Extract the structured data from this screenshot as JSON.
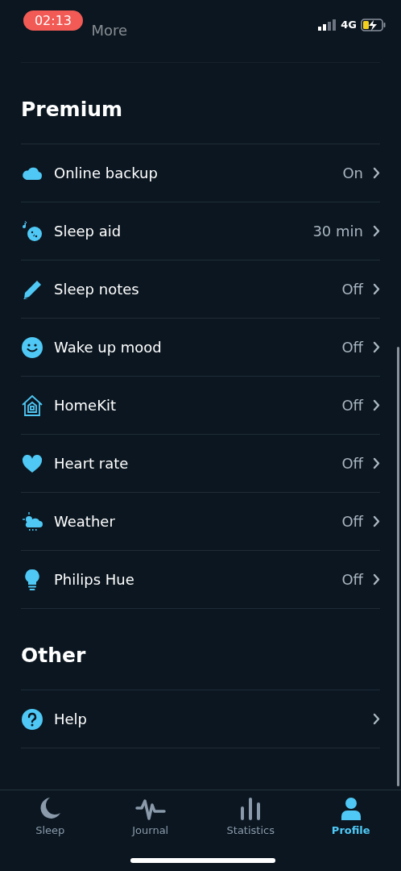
{
  "status_bar": {
    "time": "02:13",
    "network": "4G"
  },
  "partial_row": {
    "label": "More"
  },
  "sections": [
    {
      "title": "Premium",
      "items": [
        {
          "label": "Online backup",
          "value": "On"
        },
        {
          "label": "Sleep aid",
          "value": "30 min"
        },
        {
          "label": "Sleep notes",
          "value": "Off"
        },
        {
          "label": "Wake up mood",
          "value": "Off"
        },
        {
          "label": "HomeKit",
          "value": "Off"
        },
        {
          "label": "Heart rate",
          "value": "Off"
        },
        {
          "label": "Weather",
          "value": "Off"
        },
        {
          "label": "Philips Hue",
          "value": "Off"
        }
      ]
    },
    {
      "title": "Other",
      "items": [
        {
          "label": "Help"
        }
      ]
    }
  ],
  "tabs": [
    {
      "label": "Sleep",
      "selected": false
    },
    {
      "label": "Journal",
      "selected": false
    },
    {
      "label": "Statistics",
      "selected": false
    },
    {
      "label": "Profile",
      "selected": true
    }
  ]
}
